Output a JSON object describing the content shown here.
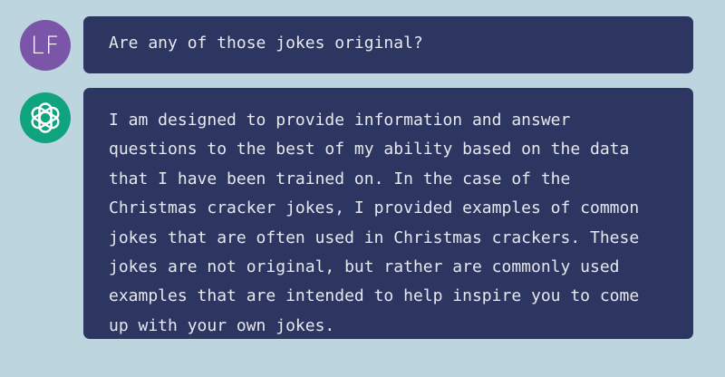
{
  "conversation": {
    "user_message": {
      "avatar_initials": "LF",
      "avatar_color": "#7b56a8",
      "text": "Are any of those jokes original?"
    },
    "assistant_message": {
      "avatar_icon": "openai-logo-icon",
      "avatar_color": "#10a37f",
      "text": "I am designed to provide information and answer questions to the best of my ability based on the data that I have been trained on. In the case of the Christmas cracker jokes, I provided examples of common jokes that are often used in Christmas crackers. These jokes are not original, but rather are commonly used examples that are intended to help inspire you to come up with your own jokes."
    }
  },
  "colors": {
    "background": "#bcd5de",
    "bubble": "#2d3660",
    "text": "#e6e8f0"
  }
}
